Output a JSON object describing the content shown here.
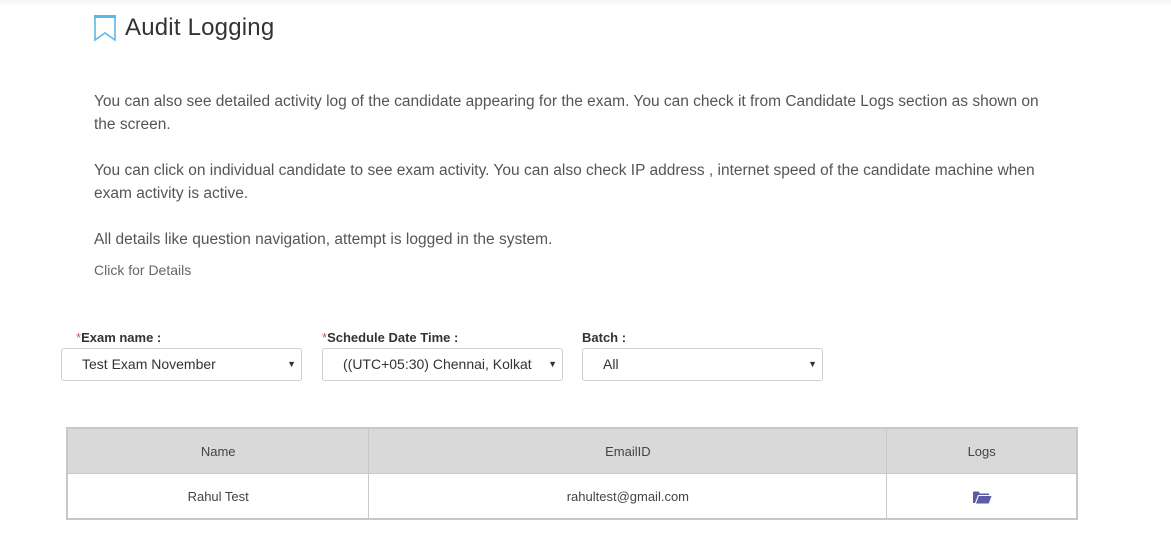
{
  "header": {
    "title": "Audit Logging",
    "icon": "bookmark-icon",
    "icon_color": "#5bb8e8"
  },
  "description": {
    "paragraph_1": "You can also see detailed activity log of the candidate appearing for the exam. You can check it from Candidate Logs section as shown on the screen.",
    "paragraph_2": "You can click on individual candidate to see exam activity. You can also check IP address , internet speed of the candidate machine when exam activity is active.",
    "paragraph_3": "All details like question navigation, attempt is logged in the system.",
    "details_link": "Click for Details"
  },
  "filters": {
    "exam": {
      "required_mark": "*",
      "label": "Exam name :",
      "value": "Test Exam November"
    },
    "schedule": {
      "required_mark": "*",
      "label": "Schedule Date Time :",
      "value": "((UTC+05:30) Chennai, Kolkat"
    },
    "batch": {
      "label": "Batch :",
      "value": "All"
    },
    "arrow_glyph": "▼"
  },
  "table": {
    "columns": [
      "Name",
      "EmailID",
      "Logs"
    ],
    "rows": [
      {
        "name": "Rahul Test",
        "email": "rahultest@gmail.com",
        "logs_icon": "folder-open-icon"
      }
    ],
    "folder_icon_color": "#5b5ba8"
  },
  "colors": {
    "required": "#d9534f",
    "table_header_bg": "#d9d9d9"
  }
}
